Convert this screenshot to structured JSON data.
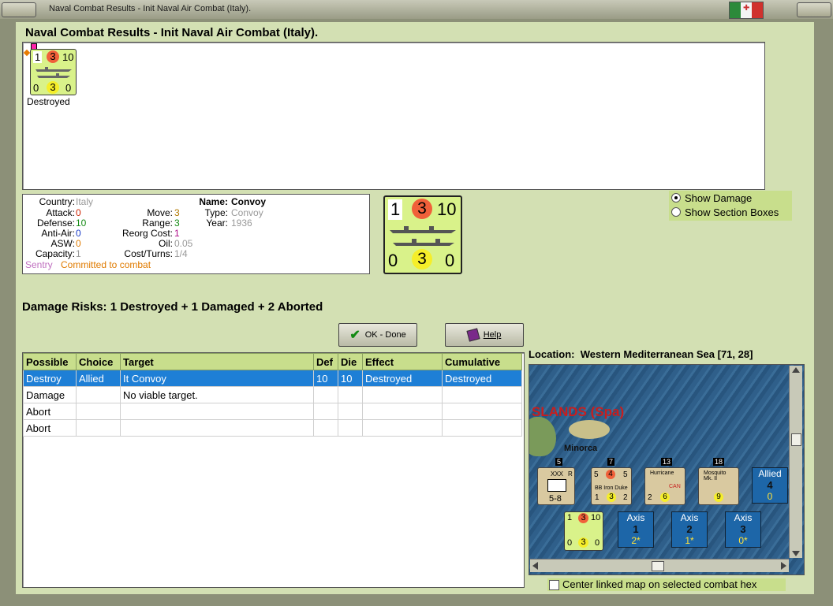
{
  "window": {
    "title": "Naval Combat Results - Init Naval Air Combat (Italy)."
  },
  "heading": "Naval Combat Results - Init Naval Air Combat (Italy).",
  "result_unit": {
    "left": "1",
    "center": "3",
    "right": "10",
    "b_left": "0",
    "b_center": "3",
    "b_right": "0",
    "status": "Destroyed"
  },
  "info": {
    "country_label": "Country:",
    "country": "Italy",
    "attack_label": "Attack:",
    "attack": "0",
    "defense_label": "Defense:",
    "defense": "10",
    "antiair_label": "Anti-Air:",
    "antiair": "0",
    "asw_label": "ASW:",
    "asw": "0",
    "capacity_label": "Capacity:",
    "capacity": "1",
    "move_label": "Move:",
    "move": "3",
    "range_label": "Range:",
    "range": "3",
    "reorg_label": "Reorg Cost:",
    "reorg": "1",
    "oil_label": "Oil:",
    "oil": "0.05",
    "cost_label": "Cost/Turns:",
    "cost": "1/4",
    "name_label": "Name:",
    "name": "Convoy",
    "type_label": "Type:",
    "type": "Convoy",
    "year_label": "Year:",
    "year": "1936",
    "sentry": "Sentry",
    "committed": "Committed to combat"
  },
  "big_counter": {
    "left": "1",
    "center": "3",
    "right": "10",
    "b_left": "0",
    "b_center": "3",
    "b_right": "0"
  },
  "options": {
    "show_damage": "Show Damage",
    "show_section_boxes": "Show Section Boxes"
  },
  "damage_risks": "Damage Risks:  1 Destroyed + 1 Damaged + 2 Aborted",
  "buttons": {
    "ok": "OK - Done",
    "help": "Help"
  },
  "table": {
    "headers": [
      "Possible",
      "Choice",
      "Target",
      "Def",
      "Die",
      "Effect",
      "Cumulative"
    ],
    "rows": [
      [
        "Destroy",
        "Allied",
        "It Convoy",
        "10",
        "10",
        "Destroyed",
        "Destroyed"
      ],
      [
        "Damage",
        "",
        "No viable target.",
        "",
        "",
        "",
        ""
      ],
      [
        "Abort",
        "",
        "",
        "",
        "",
        "",
        ""
      ],
      [
        "Abort",
        "",
        "",
        "",
        "",
        "",
        ""
      ]
    ]
  },
  "location": {
    "label": "Location:",
    "value": "Western Mediterranean Sea [71, 28]"
  },
  "map": {
    "region_label": "SLANDS (Spa)",
    "island_label": "Minorca",
    "units": [
      {
        "top": "5",
        "name": "XXX",
        "bottom": "5-8",
        "side": "R"
      },
      {
        "top": "7",
        "name": "BB Iron Duke",
        "l": "5",
        "c": "4",
        "r": "5",
        "bl": "1",
        "bc": "3",
        "br": "2"
      },
      {
        "top": "13",
        "name": "Hurricane",
        "sub": "CAN",
        "bl": "2",
        "bc": "6"
      },
      {
        "top": "18",
        "name": "Mosquito Mk. II",
        "bc": "9"
      }
    ],
    "allied_box": {
      "label": "Allied",
      "num": "4",
      "sub": "0"
    },
    "axis_boxes": [
      {
        "label": "Axis",
        "num": "1",
        "sub": "2*"
      },
      {
        "label": "Axis",
        "num": "2",
        "sub": "1*"
      },
      {
        "label": "Axis",
        "num": "3",
        "sub": "0*"
      }
    ],
    "convoy": {
      "l": "1",
      "c": "3",
      "r": "10",
      "bl": "0",
      "bc": "3",
      "br": "0"
    }
  },
  "center_map_checkbox": "Center linked map on selected combat hex",
  "colors": {
    "accent_red": "#cc2200",
    "accent_green": "#138a13",
    "accent_blue": "#1a3cc8",
    "selection": "#1e7fd6"
  }
}
